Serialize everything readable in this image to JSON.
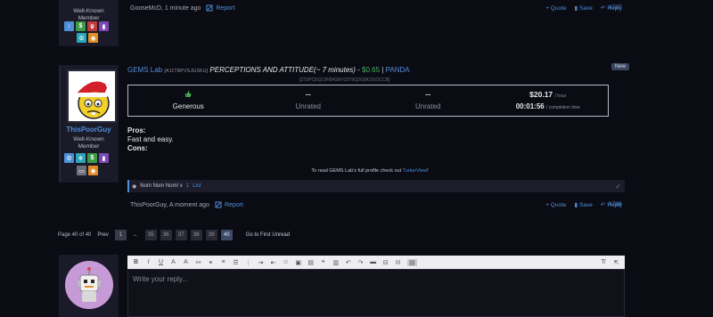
{
  "top_post": {
    "user_title": "Well-Known\nMember",
    "author_time": "GooseMcD, 1 minute ago",
    "report": "Report",
    "quote": "+ Quote",
    "save": "Save",
    "reply": "Reply",
    "post_number": "#787"
  },
  "main_post": {
    "new_badge": "New",
    "requester": "GEMS Lab",
    "requester_id": "[A11TBPVSJGSKU]",
    "task_title": "PERCEPTIONS AND ATTITUDE(~ 7 minutes)",
    "separator1": " - ",
    "pay": "$0.65",
    "separator2": " | ",
    "panda": "PANDA",
    "group_id": "[37SPCEQ13FBASRY33T9Q2G8K1ISOCCB]",
    "turkerview": {
      "generosity_label": "Generous",
      "col2_top": "--",
      "col2_bottom": "Unrated",
      "col3_top": "--",
      "col3_bottom": "Unrated",
      "hourly": "$20.17",
      "hourly_unit": "/ hour",
      "completion": "00:01:56",
      "completion_unit": "/ completion time"
    },
    "pros_label": "Pros:",
    "pros_text": "Fast and easy.",
    "cons_label": "Cons:",
    "tv_note_prefix": "To read GEMS Lab's full profile check out ",
    "tv_note_link": "TurkerView",
    "tv_note_suffix": "!",
    "likes_text": "Nom Nom Nom! x",
    "likes_count": "1",
    "likes_list": "List",
    "author_time": "ThisPoorGuy, A moment ago",
    "report": "Report",
    "quote": "+ Quote",
    "save": "Save",
    "reply": "Reply",
    "post_number": "#788",
    "username": "ThisPoorGuy",
    "user_title": "Well-Known\nMember"
  },
  "pagination": {
    "page_info": "Page 40 of 40",
    "prev": "Prev",
    "first": "1",
    "ellipsis": "←",
    "pages": [
      "35",
      "36",
      "37",
      "38",
      "39",
      "40"
    ],
    "goto_unread": "Go to First Unread"
  },
  "editor": {
    "placeholder": "Write your reply..."
  },
  "colors": {
    "background": "#0b0b14",
    "panel": "#1a1a28",
    "link": "#4e8fd8",
    "pay_green": "#45b35c"
  }
}
